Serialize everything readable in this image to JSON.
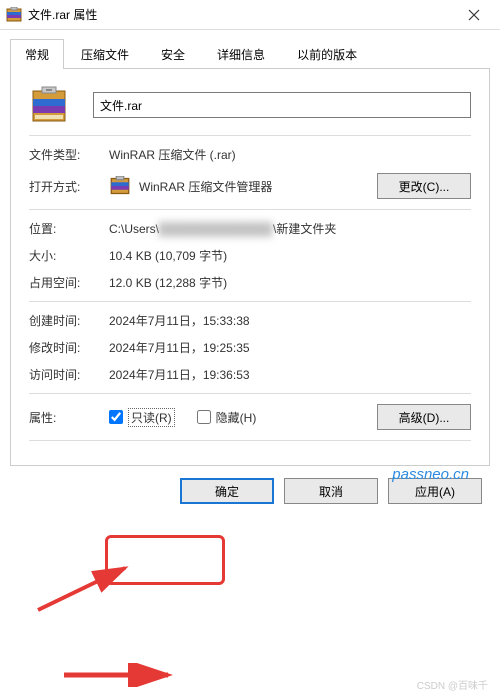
{
  "window": {
    "title": "文件.rar 属性"
  },
  "tabs": {
    "general": "常规",
    "archive": "压缩文件",
    "security": "安全",
    "details": "详细信息",
    "previous": "以前的版本"
  },
  "file": {
    "name": "文件.rar"
  },
  "rows": {
    "filetype_label": "文件类型:",
    "filetype_value": "WinRAR 压缩文件 (.rar)",
    "openwith_label": "打开方式:",
    "openwith_value": "WinRAR 压缩文件管理器",
    "change_btn": "更改(C)...",
    "location_label": "位置:",
    "location_prefix": "C:\\Users\\",
    "location_hidden": "████████████",
    "location_suffix": "\\新建文件夹",
    "size_label": "大小:",
    "size_value": "10.4 KB (10,709 字节)",
    "sizeon_label": "占用空间:",
    "sizeon_value": "12.0 KB (12,288 字节)",
    "created_label": "创建时间:",
    "created_value": "2024年7月11日，15:33:38",
    "modified_label": "修改时间:",
    "modified_value": "2024年7月11日，19:25:35",
    "accessed_label": "访问时间:",
    "accessed_value": "2024年7月11日，19:36:53",
    "attrs_label": "属性:",
    "readonly_label": "只读(R)",
    "hidden_label": "隐藏(H)",
    "advanced_btn": "高级(D)..."
  },
  "footer": {
    "ok": "确定",
    "cancel": "取消",
    "apply": "应用(A)"
  },
  "watermark": {
    "text": "passneo.cn",
    "csdn": "CSDN @百味千"
  }
}
